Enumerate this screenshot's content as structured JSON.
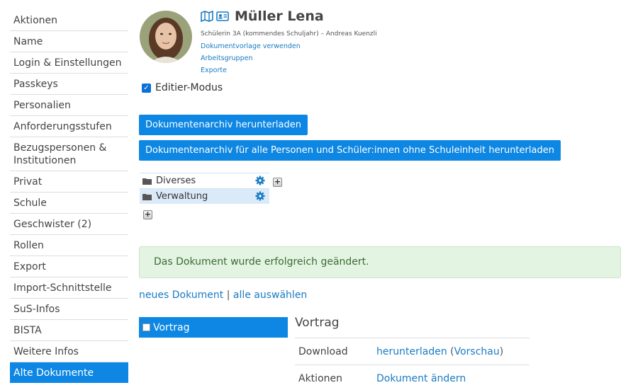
{
  "sidebar": {
    "items": [
      {
        "label": "Aktionen"
      },
      {
        "label": "Name"
      },
      {
        "label": "Login & Einstellungen"
      },
      {
        "label": "Passkeys"
      },
      {
        "label": "Personalien"
      },
      {
        "label": "Anforderungsstufen"
      },
      {
        "label": "Bezugspersonen & Institutionen"
      },
      {
        "label": "Privat"
      },
      {
        "label": "Schule"
      },
      {
        "label": "Geschwister (2)"
      },
      {
        "label": "Rollen"
      },
      {
        "label": "Export"
      },
      {
        "label": "Import-Schnittstelle"
      },
      {
        "label": "SuS-Infos"
      },
      {
        "label": "BISTA"
      },
      {
        "label": "Weitere Infos"
      },
      {
        "label": "Alte Dokumente"
      }
    ],
    "active_index": 16
  },
  "header": {
    "name": "Müller Lena",
    "subline": "Schülerin 3A (kommendes Schuljahr) – Andreas Kuenzli",
    "links": [
      "Dokumentvorlage verwenden",
      "Arbeitsgruppen",
      "Exporte"
    ],
    "icons": [
      "map-icon",
      "id-card-icon"
    ]
  },
  "edit_mode": {
    "label": "Editier-Modus",
    "checked": true
  },
  "buttons": {
    "download_archive": "Dokumentenarchiv herunterladen",
    "download_archive_all": "Dokumentenarchiv für alle Personen und Schüler:innen ohne Schuleinheit herunterladen"
  },
  "folders": [
    {
      "label": "Diverses",
      "selected": false
    },
    {
      "label": "Verwaltung",
      "selected": true
    }
  ],
  "alert": {
    "message": "Das Dokument wurde erfolgreich geändert."
  },
  "doc_links": {
    "new_document": "neues Dokument",
    "separator": "|",
    "select_all": "alle auswählen"
  },
  "documents": [
    {
      "label": "Vortrag",
      "selected": true
    }
  ],
  "detail": {
    "title": "Vortrag",
    "download_label": "Download",
    "download_link": "herunterladen",
    "preview_link": "Vorschau",
    "actions_label": "Aktionen",
    "edit_link": "Dokument ändern"
  },
  "colors": {
    "accent": "#0d87e3",
    "success_bg": "#e4f4e2",
    "success_text": "#3a6b35",
    "link": "#1a7bc4"
  }
}
